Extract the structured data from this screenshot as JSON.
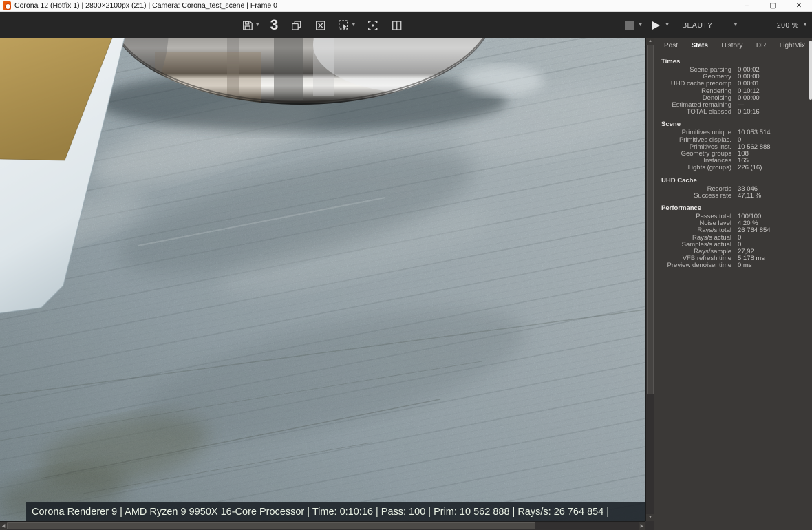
{
  "window": {
    "title": "Corona 12 (Hotfix 1) | 2800×2100px (2:1) | Camera: Corona_test_scene | Frame 0",
    "controls": {
      "minimize": "–",
      "maximize": "▢",
      "close": "✕"
    }
  },
  "toolbar": {
    "counter_label": "3",
    "render_element": "BEAUTY",
    "zoom_level": "200 %",
    "icons": [
      "save-render-icon",
      "duplicate-vfb-icon",
      "clear-vfb-icon",
      "region-render-icon",
      "focus-icon",
      "split-compare-icon",
      "stop-render-icon",
      "start-render-icon"
    ]
  },
  "panel": {
    "tabs": [
      {
        "label": "Post",
        "active": false
      },
      {
        "label": "Stats",
        "active": true
      },
      {
        "label": "History",
        "active": false
      },
      {
        "label": "DR",
        "active": false
      },
      {
        "label": "LightMix",
        "active": false
      }
    ],
    "sections": [
      {
        "title": "Times",
        "rows": [
          [
            "Scene parsing",
            "0:00:02"
          ],
          [
            "Geometry",
            "0:00:00"
          ],
          [
            "UHD cache precomp",
            "0:00:01"
          ],
          [
            "Rendering",
            "0:10:12"
          ],
          [
            "Denoising",
            "0:00:00"
          ],
          [
            "Estimated remaining",
            "---"
          ],
          [
            "TOTAL elapsed",
            "0:10:16"
          ]
        ]
      },
      {
        "title": "Scene",
        "rows": [
          [
            "Primitives unique",
            "10 053 514"
          ],
          [
            "Primitives displac.",
            "0"
          ],
          [
            "Primitives inst.",
            "10 562 888"
          ],
          [
            "Geometry groups",
            "108"
          ],
          [
            "Instances",
            "165"
          ],
          [
            "Lights (groups)",
            "226 (16)"
          ]
        ]
      },
      {
        "title": "UHD Cache",
        "rows": [
          [
            "Records",
            "33 046"
          ],
          [
            "Success rate",
            "47,11 %"
          ]
        ]
      },
      {
        "title": "Performance",
        "rows": [
          [
            "Passes total",
            "100/100"
          ],
          [
            "Noise level",
            "4,20 %"
          ],
          [
            "Rays/s total",
            "26 764 854"
          ],
          [
            "Rays/s actual",
            "0"
          ],
          [
            "Samples/s actual",
            "0"
          ],
          [
            "Rays/sample",
            "27,92"
          ],
          [
            "VFB refresh time",
            "5 178 ms"
          ],
          [
            "Preview denoiser time",
            "0 ms"
          ]
        ]
      }
    ]
  },
  "statusbar": {
    "text": "Corona Renderer 9 | AMD Ryzen 9 9950X 16-Core Processor  | Time: 0:10:16 | Pass: 100 | Prim: 10 562 888 | Rays/s: 26 764 854 |"
  },
  "colors": {
    "accent_orange": "#e8590c",
    "titlebar_bg": "#fafafa",
    "toolbar_bg": "#262626",
    "panel_bg": "#3b3937",
    "status_bg": "#1a2025",
    "status_text": "#e9f1e4"
  }
}
